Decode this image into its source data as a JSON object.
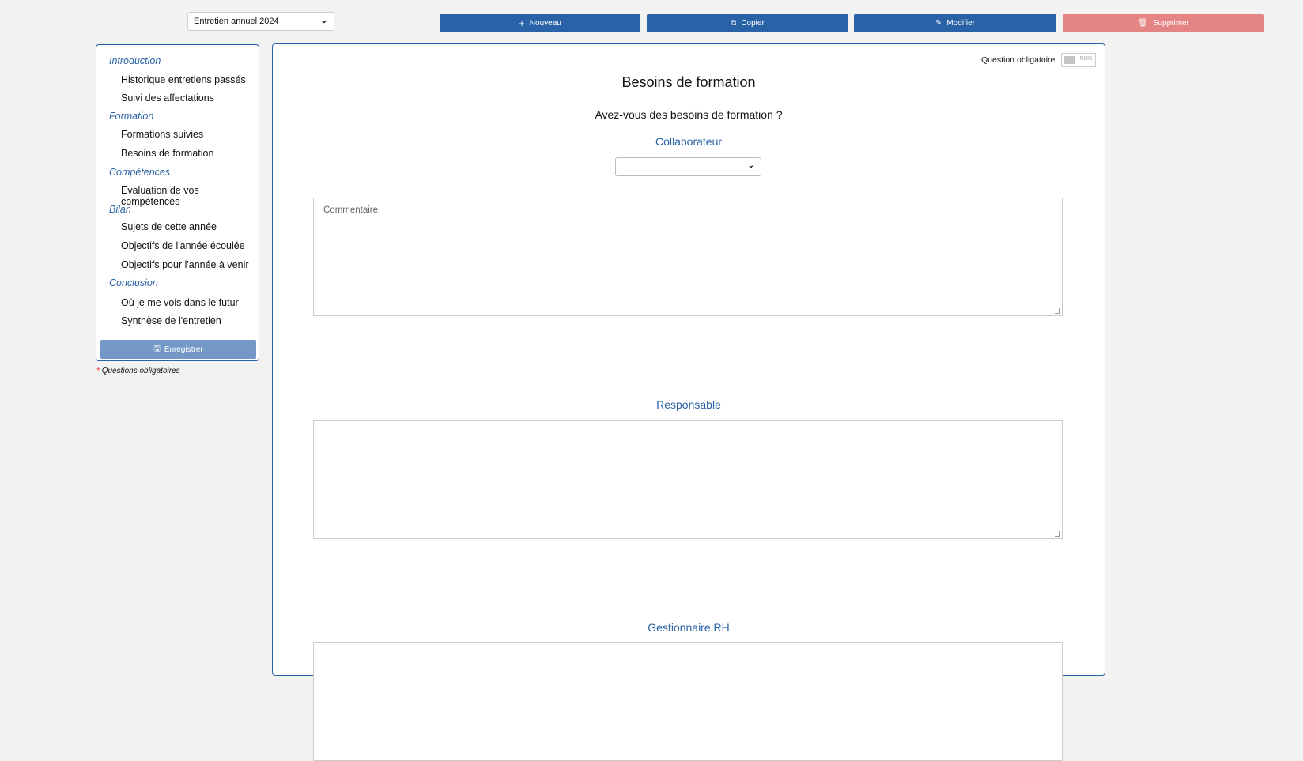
{
  "interview_select": {
    "value": "Entretien annuel 2024"
  },
  "toolbar": {
    "new": {
      "label": "Nouveau",
      "icon": "plus-icon"
    },
    "copy": {
      "label": "Copier",
      "icon": "copy-icon"
    },
    "edit": {
      "label": "Modifier",
      "icon": "pencil-icon"
    },
    "delete": {
      "label": "Supprimer",
      "icon": "trash-icon"
    }
  },
  "colors": {
    "primary": "#2962a6",
    "danger": "#e58484",
    "save": "#7398c6"
  },
  "sidebar": {
    "sections": [
      {
        "label": "Introduction",
        "items": [
          "Historique entretiens passés",
          "Suivi des affectations"
        ]
      },
      {
        "label": "Formation",
        "items": [
          "Formations suivies",
          "Besoins de formation"
        ]
      },
      {
        "label": "Compétences",
        "items": [
          "Evaluation de vos compétences"
        ]
      },
      {
        "label": "Bilan",
        "items": [
          "Sujets de cette année",
          "Objectifs de l'année écoulée",
          "Objectifs pour l'année à venir"
        ]
      },
      {
        "label": "Conclusion",
        "items": [
          "Où je me vois dans le futur",
          "Synthèse de l'entretien"
        ]
      }
    ],
    "save_label": "Enregistrer",
    "required_note_star": "*",
    "required_note": "Questions obligatoires"
  },
  "main": {
    "required_label": "Question obligatoire",
    "required_toggle": "NON",
    "title": "Besoins de formation",
    "question": "Avez-vous des besoins de formation ?",
    "collaborator": {
      "label": "Collaborateur",
      "select_value": "",
      "comment_placeholder": "Commentaire"
    },
    "manager": {
      "label": "Responsable"
    },
    "hr": {
      "label": "Gestionnaire RH"
    }
  }
}
